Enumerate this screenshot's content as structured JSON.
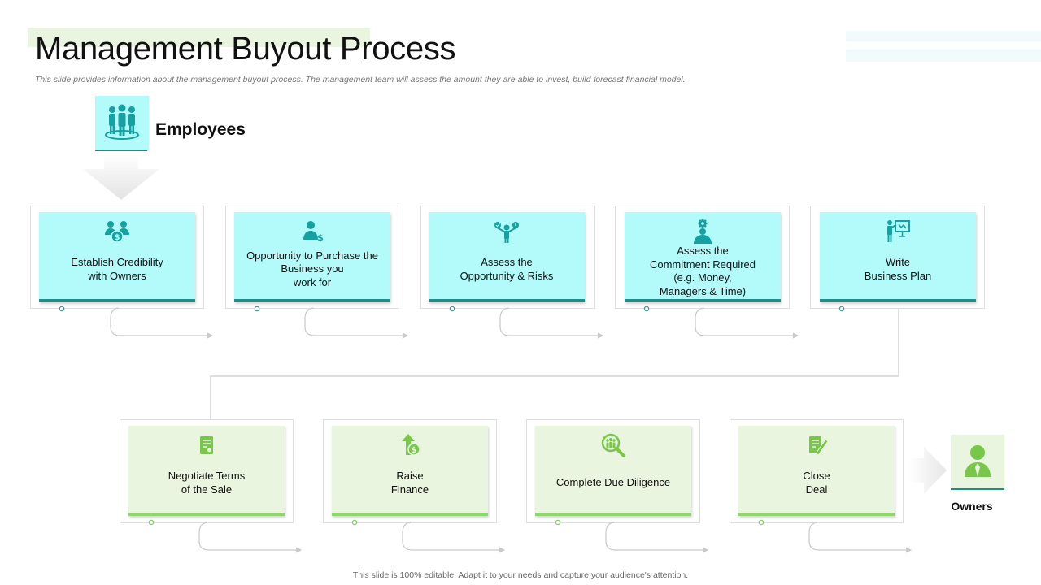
{
  "title": "Management Buyout Process",
  "subtitle": "This slide provides information about the management buyout process. The management team will assess the amount they are able to invest, build forecast financial model.",
  "footer": "This slide is 100% editable. Adapt it to your needs and capture your audience's attention.",
  "employees": {
    "label": "Employees",
    "icon": "employees-group-icon"
  },
  "owners": {
    "label": "Owners",
    "icon": "owner-person-icon"
  },
  "colors": {
    "teal_fill": "#b3fbfb",
    "teal_accent": "#1c8f8b",
    "teal_icon": "#15a1a1",
    "green_fill": "#eaf5df",
    "green_accent": "#8fd66b",
    "green_icon": "#79c74a"
  },
  "employee_steps": [
    {
      "label": "Establish Credibility\nwith Owners",
      "icon": "people-dollar-icon"
    },
    {
      "label": "Opportunity to Purchase the\nBusiness you\nwork for",
      "icon": "person-dollar-icon"
    },
    {
      "label": "Assess the\nOpportunity & Risks",
      "icon": "balance-person-icon"
    },
    {
      "label": "Assess the\nCommitment Required\n(e.g. Money,\nManagers & Time)",
      "icon": "person-gear-icon"
    },
    {
      "label": "Write\nBusiness Plan",
      "icon": "presenter-board-icon"
    }
  ],
  "owner_steps": [
    {
      "label": "Negotiate Terms\nof the Sale",
      "icon": "contract-document-icon"
    },
    {
      "label": "Raise\nFinance",
      "icon": "arrow-up-coin-icon"
    },
    {
      "label": "Complete Due Diligence",
      "icon": "magnifier-people-icon"
    },
    {
      "label": "Close\nDeal",
      "icon": "document-pen-icon"
    }
  ]
}
